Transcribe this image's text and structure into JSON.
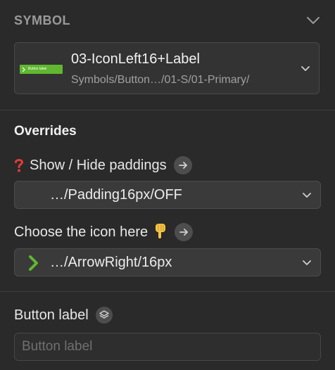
{
  "symbol_section": {
    "title": "SYMBOL",
    "thumbnail_label": "Button label",
    "symbol_name": "03-IconLeft16+Label",
    "symbol_path": "Symbols/Button…/01-S/01-Primary/"
  },
  "overrides": {
    "title": "Overrides",
    "paddings": {
      "label": "Show / Hide paddings",
      "value": "…/Padding16px/OFF"
    },
    "icon": {
      "label": "Choose the icon here",
      "value": "…/ArrowRight/16px"
    },
    "button_label": {
      "label": "Button label",
      "value": "",
      "placeholder": "Button label"
    }
  },
  "colors": {
    "panel_bg": "#2a2a2a",
    "accent_green": "#5fb82f",
    "question_red": "#e03b3b",
    "hand_yellow": "#f5c443"
  },
  "icons": {
    "collapse": "chevron-down-icon",
    "paddings_lead": "red-question-mark-icon",
    "go": "arrow-right-circle-icon",
    "hand": "pointing-down-hand-icon",
    "select_icon": "green-chevron-right-icon",
    "layers": "layers-icon"
  }
}
